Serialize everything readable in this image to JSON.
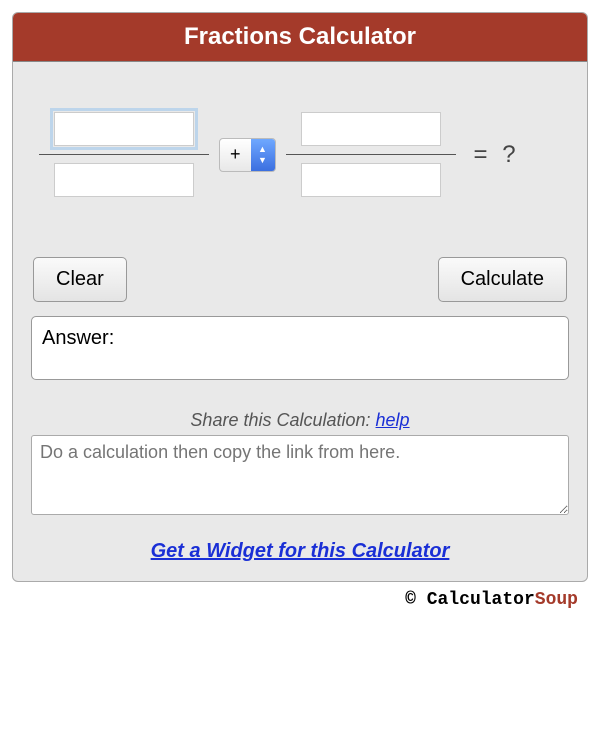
{
  "header": {
    "title": "Fractions Calculator"
  },
  "fractions": {
    "num1": "",
    "den1": "",
    "num2": "",
    "den2": "",
    "operator": "+",
    "result_text": "=  ?"
  },
  "buttons": {
    "clear": "Clear",
    "calculate": "Calculate"
  },
  "answer": {
    "label": "Answer:"
  },
  "share": {
    "label": "Share this Calculation: ",
    "help_text": "help",
    "placeholder": "Do a calculation then copy the link from here."
  },
  "widget": {
    "link_text": "Get a Widget for this Calculator"
  },
  "footer": {
    "copyright": "© ",
    "brand1": "Calculator",
    "brand2": "Soup"
  }
}
